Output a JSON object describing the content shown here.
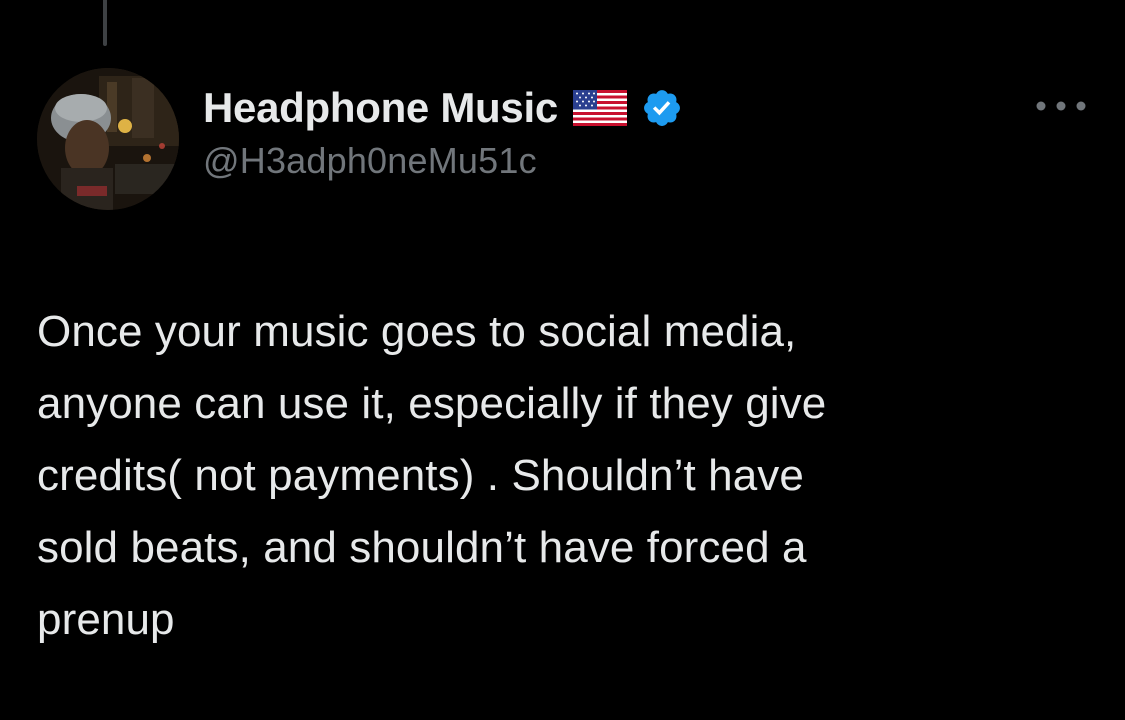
{
  "tweet": {
    "author": {
      "display_name": "Headphone Music",
      "handle": "@H3adph0neMu51c",
      "flag_icon": "us-flag-icon",
      "verified_icon": "verified-badge-icon",
      "avatar_icon": "user-avatar-photo"
    },
    "more_icon": "more-options-icon",
    "text": "Once your music goes to social media,\nanyone can use it, especially if they give\ncredits( not payments) . Shouldn’t have\nsold beats, and shouldn’t have forced a\nprenup"
  },
  "colors": {
    "background": "#000000",
    "primary_text": "#e7e9ea",
    "secondary_text": "#71767b",
    "verified_blue": "#1d9bf0",
    "thread_line": "#3e4144"
  }
}
